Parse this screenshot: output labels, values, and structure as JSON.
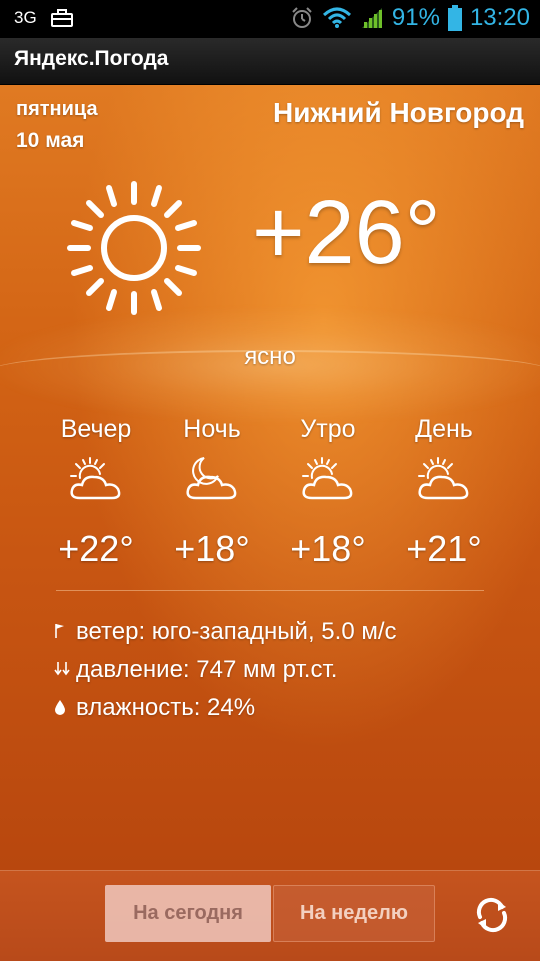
{
  "status": {
    "network": "3G",
    "battery": "91%",
    "time": "13:20",
    "icons": [
      "briefcase-icon",
      "alarm-icon",
      "wifi-icon",
      "signal-icon",
      "battery-icon"
    ]
  },
  "app": {
    "title": "Яндекс.Погода"
  },
  "current": {
    "day": "пятница",
    "date": "10 мая",
    "city": "Нижний Новгород",
    "temperature": "+26°",
    "condition": "ясно",
    "icon": "sun-icon"
  },
  "periods": [
    {
      "name": "Вечер",
      "temp": "+22°",
      "icon": "sun-cloud-icon"
    },
    {
      "name": "Ночь",
      "temp": "+18°",
      "icon": "moon-cloud-icon"
    },
    {
      "name": "Утро",
      "temp": "+18°",
      "icon": "sun-cloud-icon"
    },
    {
      "name": "День",
      "temp": "+21°",
      "icon": "sun-cloud-icon"
    }
  ],
  "details": {
    "wind": "ветер: юго-западный, 5.0 м/с",
    "pressure": "давление: 747 мм рт.ст.",
    "humidity": "влажность: 24%"
  },
  "tabs": {
    "today": "На сегодня",
    "week": "На неделю",
    "selected": "today"
  },
  "colors": {
    "accent": "#33b5e5",
    "background": "#d26314"
  }
}
